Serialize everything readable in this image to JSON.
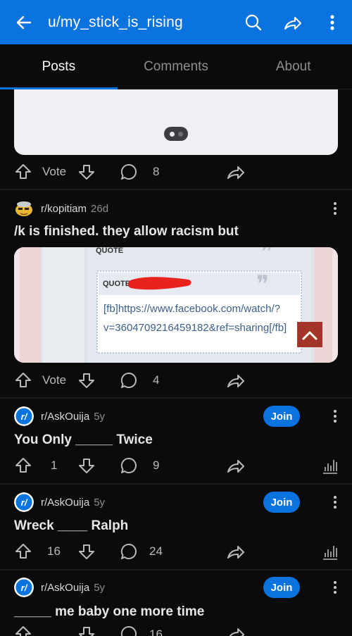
{
  "appbar": {
    "title": "u/my_stick_is_rising",
    "back_icon": "arrow-left-icon",
    "search_icon": "search-icon",
    "share_icon": "share-icon",
    "menu_icon": "more-vertical-icon",
    "color": "#0a73e0"
  },
  "tabs": [
    {
      "label": "Posts",
      "active": true
    },
    {
      "label": "Comments",
      "active": false
    },
    {
      "label": "About",
      "active": false
    }
  ],
  "posts": [
    {
      "score": "Vote",
      "comments": "8"
    },
    {
      "subreddit": "r/kopitiam",
      "age": "26d",
      "title": "/k is finished. they allow racism but",
      "image": {
        "quote_label": "QUOTE",
        "inner_quote_label": "QUOTE=",
        "link_text": "[fb]https://www.facebook.com/watch/?v=3604709216459182&ref=sharing[/fb]"
      },
      "score": "Vote",
      "comments": "4"
    },
    {
      "subreddit": "r/AskOuija",
      "age": "5y",
      "title": "You Only _____ Twice",
      "join": "Join",
      "score": "1",
      "comments": "9"
    },
    {
      "subreddit": "r/AskOuija",
      "age": "5y",
      "title": "Wreck ____ Ralph",
      "join": "Join",
      "score": "16",
      "comments": "24"
    },
    {
      "subreddit": "r/AskOuija",
      "age": "5y",
      "title": "_____ me baby one more time",
      "join": "Join",
      "score": "",
      "comments": "16"
    }
  ]
}
